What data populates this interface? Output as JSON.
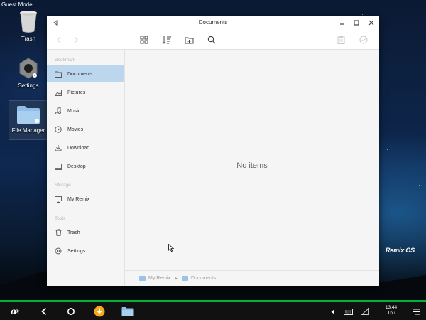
{
  "desktop": {
    "mode_label": "Guest Mode",
    "icons": [
      {
        "label": "Trash",
        "icon": "trash-icon"
      },
      {
        "label": "Settings",
        "icon": "settings-gear-icon"
      },
      {
        "label": "File Manager",
        "icon": "folder-icon"
      }
    ],
    "wallpaper_logo": "Remix OS"
  },
  "window": {
    "title": "Documents",
    "controls": [
      "back-arrow-icon",
      "minimize-icon",
      "maximize-icon",
      "close-icon"
    ],
    "toolbar": [
      "nav-back-icon",
      "nav-forward-icon",
      "grid-view-icon",
      "sort-icon",
      "new-folder-icon",
      "search-icon",
      "clipboard-icon",
      "check-circle-icon"
    ]
  },
  "sidebar": {
    "sections": [
      {
        "label": "Bookmark",
        "items": [
          {
            "label": "Documents",
            "icon": "folder-icon",
            "active": true
          },
          {
            "label": "Pictures",
            "icon": "picture-icon"
          },
          {
            "label": "Music",
            "icon": "music-note-icon"
          },
          {
            "label": "Movies",
            "icon": "play-circle-icon"
          },
          {
            "label": "Download",
            "icon": "download-icon"
          },
          {
            "label": "Desktop",
            "icon": "desktop-icon"
          }
        ]
      },
      {
        "label": "Storage",
        "items": [
          {
            "label": "My Remix",
            "icon": "monitor-icon"
          }
        ]
      },
      {
        "label": "Tools",
        "items": [
          {
            "label": "Trash",
            "icon": "trash-icon"
          },
          {
            "label": "Settings",
            "icon": "gear-icon"
          }
        ]
      }
    ]
  },
  "content": {
    "empty_message": "No items"
  },
  "pathbar": {
    "crumbs": [
      "My Remix",
      "Documents"
    ]
  },
  "taskbar": {
    "items": [
      "remix-start-icon",
      "back-icon",
      "home-circle-icon",
      "download-app-icon",
      "file-manager-icon"
    ],
    "tray": [
      "tray-arrow-icon",
      "keyboard-icon",
      "signal-icon",
      "notification-menu-icon"
    ],
    "clock_time": "13:44",
    "clock_day": "Thu"
  },
  "colors": {
    "accent_taskbar": "#00b140",
    "sidebar_active": "#bcd6ee",
    "folder": "#8fbde6"
  }
}
